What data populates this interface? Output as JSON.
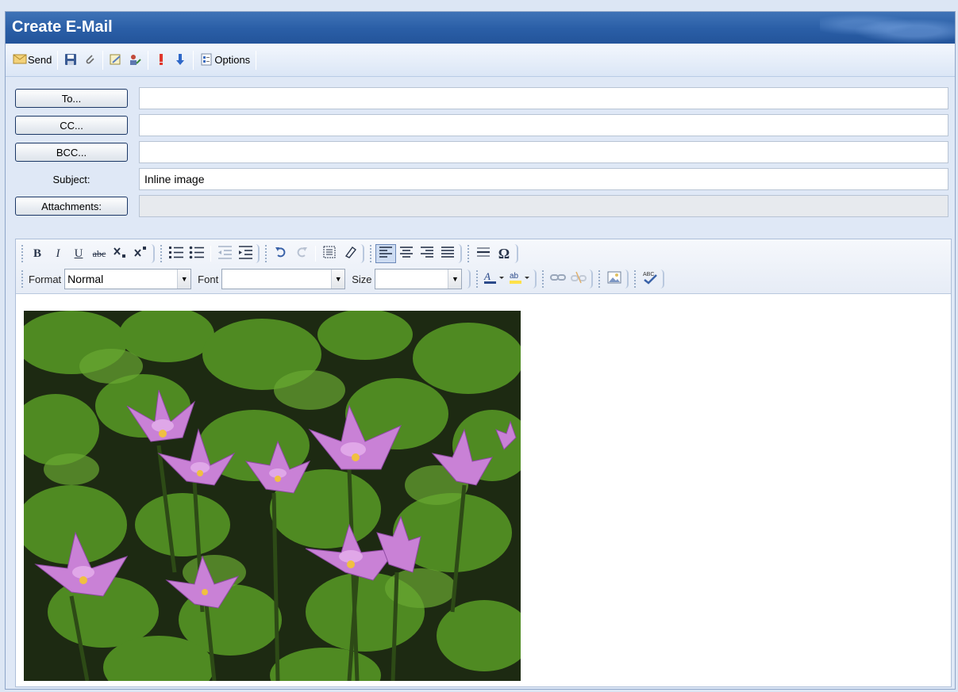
{
  "window": {
    "title": "Create E-Mail"
  },
  "toolbar": {
    "send_label": "Send",
    "options_label": "Options",
    "icons": [
      "send-icon",
      "save-icon",
      "attach-icon",
      "template-icon",
      "address-book-icon",
      "high-priority-icon",
      "low-priority-icon",
      "options-icon"
    ]
  },
  "fields": {
    "to_button": "To...",
    "to_value": "",
    "cc_button": "CC...",
    "cc_value": "",
    "bcc_button": "BCC...",
    "bcc_value": "",
    "subject_label": "Subject:",
    "subject_value": "Inline image",
    "attachments_button": "Attachments:",
    "attachments_value": ""
  },
  "editor": {
    "format_label": "Format",
    "format_value": "Normal",
    "font_label": "Font",
    "font_value": "",
    "size_label": "Size",
    "size_value": "",
    "bold_glyph": "B",
    "italic_glyph": "I",
    "underline_glyph": "U",
    "strike_glyph": "abc",
    "omega_glyph": "Ω",
    "active_alignment": "left"
  },
  "colors": {
    "title_bar": "#2a5ea6",
    "window_bg": "#dfe8f6",
    "button_border": "#1b3766"
  }
}
